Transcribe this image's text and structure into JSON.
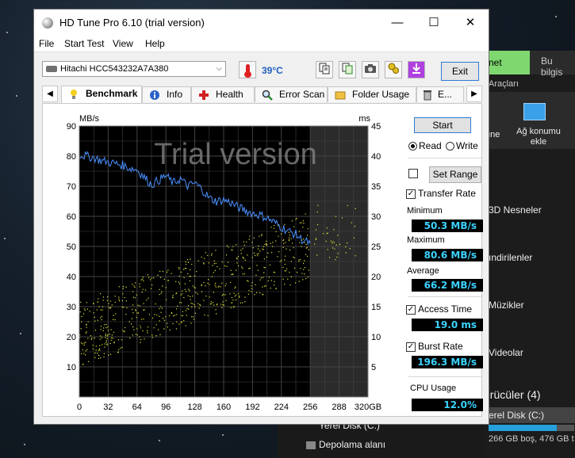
{
  "window": {
    "title": "HD Tune Pro 6.10 (trial version)",
    "controls": {
      "minimize": "—",
      "maximize": "☐",
      "close": "✕"
    }
  },
  "menu": [
    "File",
    "Start Test",
    "View",
    "Help"
  ],
  "toolbar": {
    "drive": "Hitachi HCC543232A7A380",
    "temperature": "39°C",
    "exit_label": "Exit",
    "buttons": [
      "copy-text-icon",
      "copy-all-icon",
      "screenshot-icon",
      "options-icon",
      "save-icon"
    ]
  },
  "tabs": [
    {
      "label": "Benchmark",
      "icon": "lightbulb-icon",
      "active": true
    },
    {
      "label": "Info",
      "icon": "info-icon"
    },
    {
      "label": "Health",
      "icon": "health-cross-icon"
    },
    {
      "label": "Error Scan",
      "icon": "magnifier-icon"
    },
    {
      "label": "Folder Usage",
      "icon": "folder-icon"
    },
    {
      "label": "E...",
      "icon": "trash-icon"
    }
  ],
  "benchmark": {
    "start_label": "Start",
    "read_label": "Read",
    "write_label": "Write",
    "mode": "Read",
    "set_range_label": "Set Range",
    "transfer_rate_label": "Transfer Rate",
    "minimum_label": "Minimum",
    "minimum_value": "50.3 MB/s",
    "maximum_label": "Maximum",
    "maximum_value": "80.6 MB/s",
    "average_label": "Average",
    "average_value": "66.2 MB/s",
    "access_time_label": "Access Time",
    "access_time_value": "19.0 ms",
    "burst_rate_label": "Burst Rate",
    "burst_rate_value": "196.3 MB/s",
    "cpu_usage_label": "CPU Usage",
    "cpu_usage_value": "12.0%",
    "transfer_rate_checked": true,
    "access_time_checked": true,
    "burst_rate_checked": true
  },
  "chart_data": {
    "type": "line",
    "watermark": "Trial version",
    "ylabel_left": "MB/s",
    "ylabel_right": "ms",
    "x_ticks": [
      "0",
      "32",
      "64",
      "96",
      "128",
      "160",
      "192",
      "224",
      "256",
      "288",
      "320GB"
    ],
    "y_left_ticks": [
      "10",
      "20",
      "30",
      "40",
      "50",
      "60",
      "70",
      "80",
      "90"
    ],
    "y_right_ticks": [
      "5",
      "10",
      "15",
      "20",
      "25",
      "30",
      "35",
      "40",
      "45"
    ],
    "xlim": [
      0,
      320
    ],
    "ylim_left": [
      0,
      90
    ],
    "ylim_right": [
      0,
      45
    ],
    "tested_until_gb": 256,
    "grid": true,
    "series": [
      {
        "kind": "transfer-rate-line",
        "color": "#4a90ff",
        "axis": "left",
        "x": [
          0,
          8,
          16,
          24,
          32,
          40,
          48,
          56,
          64,
          72,
          80,
          88,
          96,
          104,
          112,
          120,
          128,
          136,
          144,
          152,
          160,
          168,
          176,
          184,
          192,
          200,
          208,
          216,
          224,
          232,
          240,
          248,
          256
        ],
        "y": [
          80.5,
          80,
          79.5,
          78.5,
          78,
          77.5,
          77,
          76,
          75.5,
          73,
          70.5,
          72,
          73.5,
          71,
          72.5,
          70,
          71,
          69,
          66,
          65,
          65.5,
          64.5,
          63,
          62,
          61,
          60.5,
          59.5,
          58,
          56.5,
          55,
          54,
          52,
          51
        ]
      },
      {
        "kind": "access-time-scatter",
        "color": "#e8e838",
        "axis": "right",
        "x_range": [
          0,
          256
        ],
        "y_min_start": 5,
        "y_min_end": 20,
        "spread": 11
      }
    ]
  },
  "background": {
    "explorer_tab": "net",
    "explorer_tab2": "Bu bilgis",
    "explorer_tools": "Araçları",
    "cmd_left": "üne",
    "cmd_label": "Ağ konumu ekle",
    "items": [
      "3D Nesneler",
      "ındirilenler",
      "Müzikler",
      "Videolar"
    ],
    "section": "ürücüler (4)",
    "drive": "erel Disk (C:)",
    "drive_caption": "266 GB boş, 476 GB t",
    "taskbar_rows": [
      "Yerel Disk (C:)",
      "Depolama alanı"
    ]
  }
}
